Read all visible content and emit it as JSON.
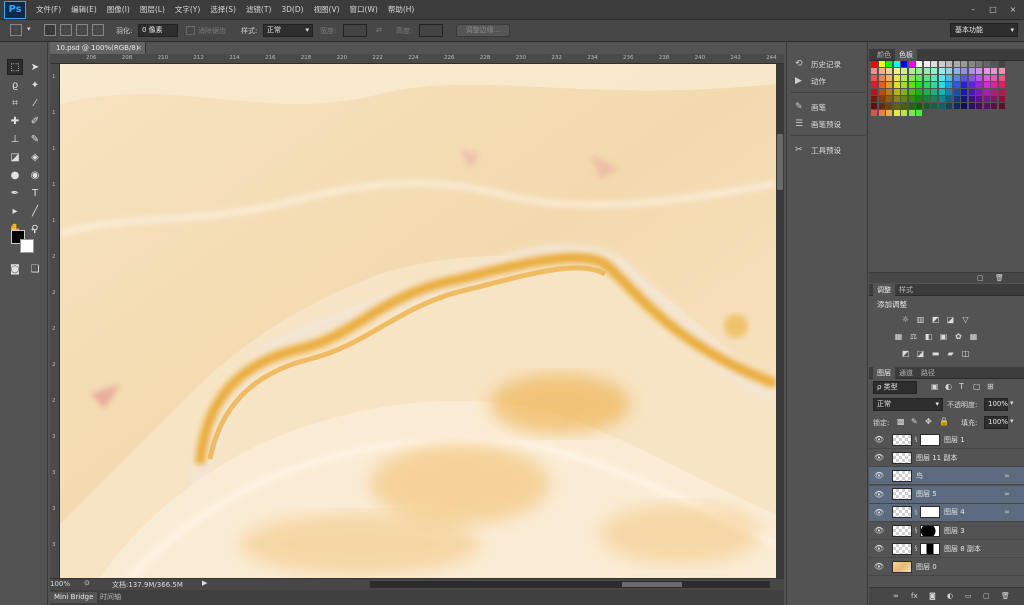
{
  "app": {
    "logo": "Ps"
  },
  "menu": [
    "文件(F)",
    "编辑(E)",
    "图像(I)",
    "图层(L)",
    "文字(Y)",
    "选择(S)",
    "滤镜(T)",
    "3D(D)",
    "视图(V)",
    "窗口(W)",
    "帮助(H)"
  ],
  "window_controls": [
    "–",
    "□",
    "×"
  ],
  "options": {
    "feather_label": "羽化:",
    "feather_value": "0 像素",
    "antialias_label": "消除锯齿",
    "style_label": "样式:",
    "style_value": "正常",
    "width_label": "宽度:",
    "height_label": "高度:",
    "refine_edge": "调整边缘..."
  },
  "workspace": "基本功能",
  "document": {
    "tab_title": "10.psd @ 100%(RGB/8)",
    "close": "×",
    "zoom": "100%",
    "doc_info": "文档:137.9M/366.5M",
    "ruler_top": [
      "206",
      "208",
      "210",
      "212",
      "214",
      "216",
      "218",
      "220",
      "222",
      "224",
      "226",
      "228",
      "230",
      "232",
      "234",
      "236",
      "238",
      "240",
      "242",
      "244"
    ],
    "ruler_left": [
      "1",
      "1",
      "1",
      "1",
      "1",
      "2",
      "2",
      "2",
      "2",
      "2",
      "3",
      "3",
      "3",
      "3"
    ]
  },
  "bottom_tabs": [
    "Mini Bridge",
    "时间轴"
  ],
  "middle_panel": [
    {
      "icon": "history-icon",
      "glyph": "⟲",
      "label": "历史记录"
    },
    {
      "icon": "actions-icon",
      "glyph": "▶",
      "label": "动作"
    },
    {
      "icon": "brush-icon",
      "glyph": "✎",
      "label": "画笔"
    },
    {
      "icon": "brush-presets-icon",
      "glyph": "☰",
      "label": "画笔预设"
    },
    {
      "icon": "tool-presets-icon",
      "glyph": "✂",
      "label": "工具预设"
    }
  ],
  "panels": {
    "color_tabs": [
      "颜色",
      "色板"
    ],
    "adjust_tabs": [
      "调整",
      "样式"
    ],
    "adjust_title": "添加调整",
    "layers_tabs": [
      "图层",
      "通道",
      "路径"
    ],
    "layer_filter": "ρ 类型",
    "blend_mode": "正常",
    "opacity_label": "不透明度:",
    "opacity_value": "100%",
    "lock_label": "锁定:",
    "fill_label": "填充:",
    "fill_value": "100%"
  },
  "layers": [
    {
      "name": "图层 1",
      "mask": "white",
      "selected": false,
      "fx": ""
    },
    {
      "name": "图层 11 副本",
      "mask": "",
      "selected": false,
      "fx": ""
    },
    {
      "name": "鸟",
      "mask": "",
      "selected": true,
      "fx": "∞"
    },
    {
      "name": "图层 5",
      "mask": "",
      "selected": true,
      "fx": "∞"
    },
    {
      "name": "图层 4",
      "mask": "white",
      "selected": true,
      "fx": "∞"
    },
    {
      "name": "图层 3",
      "mask": "black",
      "selected": false,
      "fx": ""
    },
    {
      "name": "图层 8 副本",
      "mask": "blackwhite",
      "selected": false,
      "fx": ""
    },
    {
      "name": "图层 0",
      "mask": "marble",
      "selected": false,
      "fx": ""
    }
  ],
  "colors": {
    "accent": "#31a8ff",
    "selected_layer": "#5d6b80",
    "marble_base": "#f3dcb6",
    "marble_vein": "#e8a324"
  }
}
